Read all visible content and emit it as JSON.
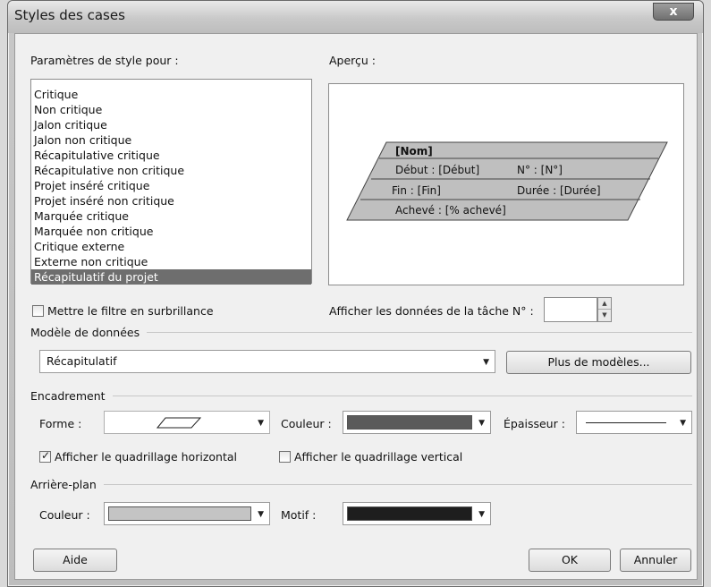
{
  "window": {
    "title": "Styles des cases",
    "close_label": "x"
  },
  "settings_label": "Paramètres de style pour :",
  "preview_label": "Aperçu :",
  "style_list": [
    "Critique",
    "Non critique",
    "Jalon critique",
    "Jalon non critique",
    "Récapitulative critique",
    "Récapitulative non critique",
    "Projet inséré critique",
    "Projet inséré non critique",
    "Marquée critique",
    "Marquée non critique",
    "Critique externe",
    "Externe non critique",
    "Récapitulatif du projet"
  ],
  "selected_style": "Récapitulatif du projet",
  "preview_box": {
    "name": "[Nom]",
    "start": "Début : [Début]",
    "id": "N° :  [N°]",
    "finish": "Fin : [Fin]",
    "duration": "Durée : [Durée]",
    "complete": "Achevé : [% achevé]"
  },
  "highlight_filter": {
    "label": "Mettre le filtre en surbrillance",
    "checked": false
  },
  "show_task_data": {
    "label": "Afficher les données de la tâche N° :",
    "value": ""
  },
  "data_model": {
    "group_title": "Modèle de données",
    "value": "Récapitulatif",
    "more_button": "Plus de modèles..."
  },
  "border": {
    "group_title": "Encadrement",
    "shape_label": "Forme :",
    "shape_icon": "parallelogram-icon",
    "color_label": "Couleur :",
    "color_value": "#5a5a5a",
    "thickness_label": "Épaisseur :",
    "horizontal_grid": {
      "label": "Afficher le quadrillage horizontal",
      "checked": true
    },
    "vertical_grid": {
      "label": "Afficher le quadrillage vertical",
      "checked": false
    }
  },
  "background": {
    "group_title": "Arrière-plan",
    "color_label": "Couleur :",
    "color_value": "#c4c4c4",
    "pattern_label": "Motif :",
    "pattern_value": "#1e1e1e"
  },
  "buttons": {
    "help": "Aide",
    "ok": "OK",
    "cancel": "Annuler"
  }
}
